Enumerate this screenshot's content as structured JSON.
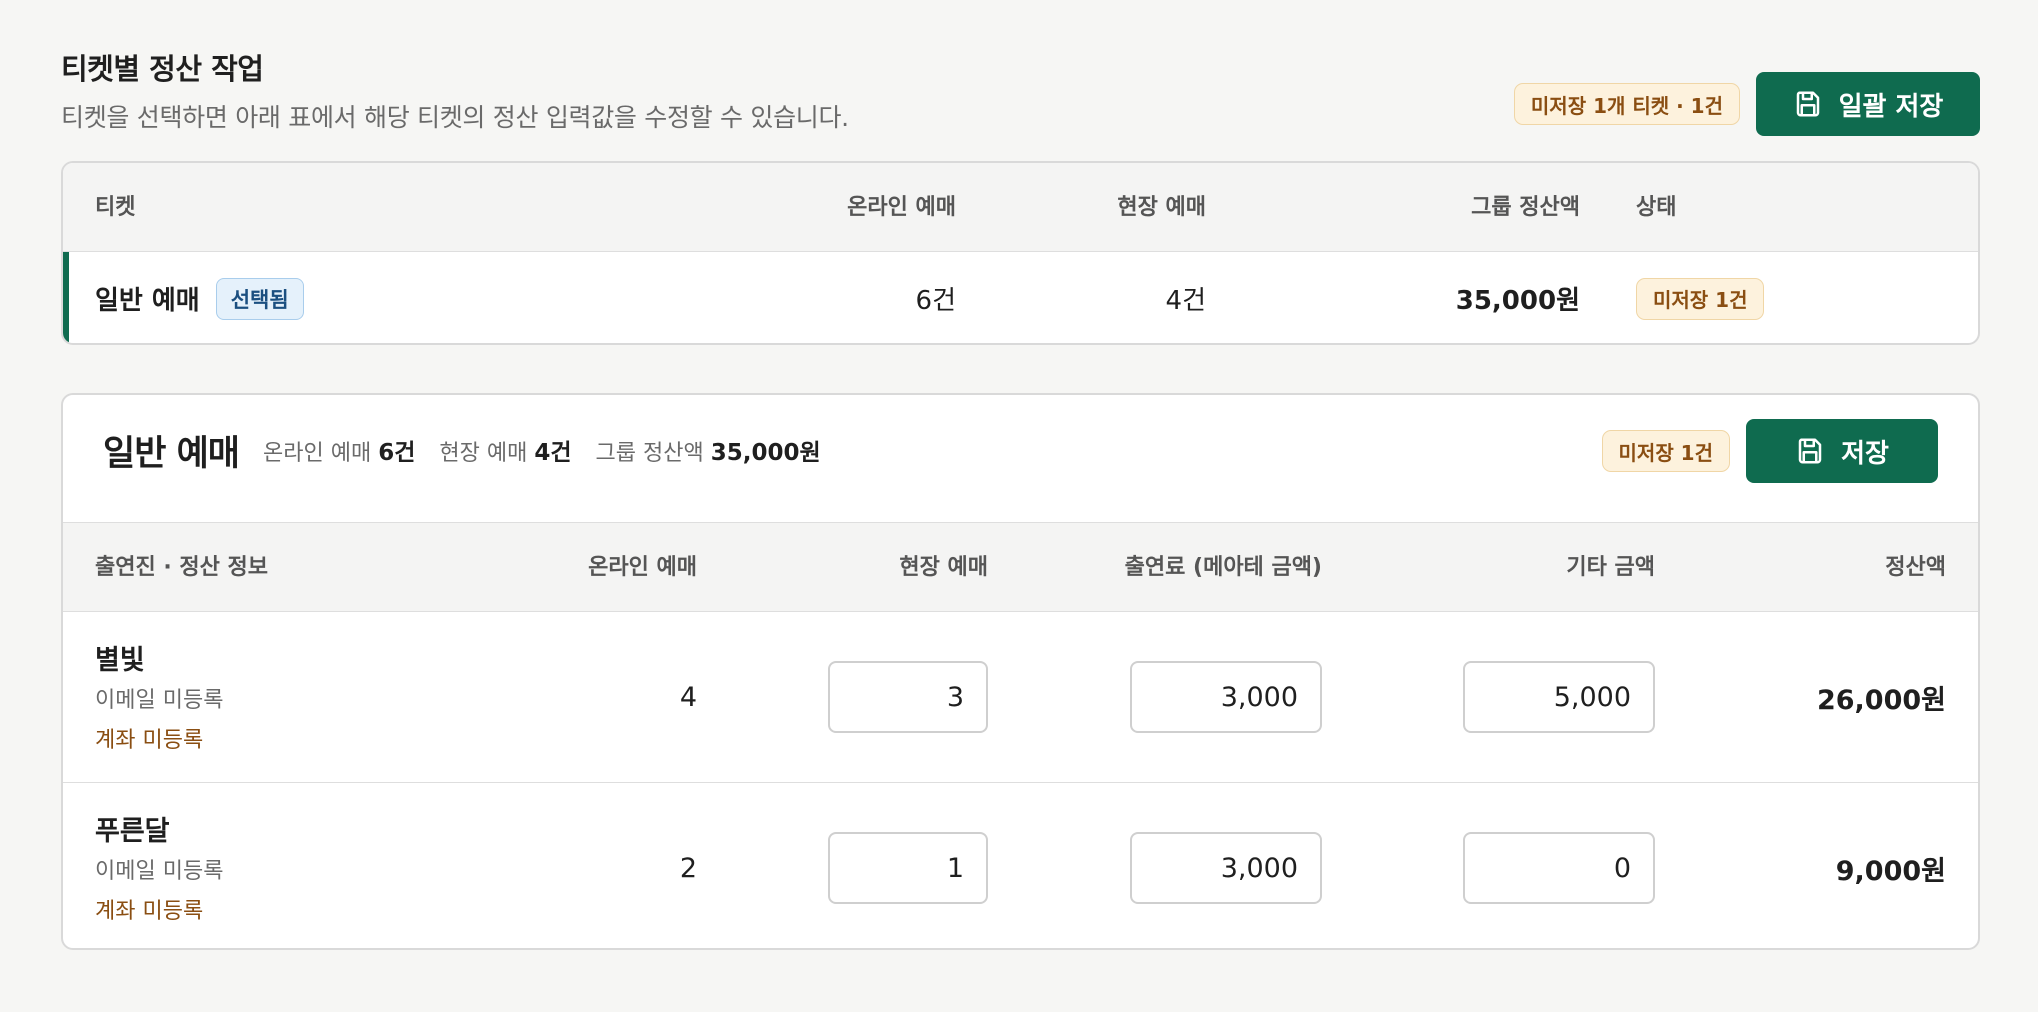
{
  "header": {
    "title": "티켓별 정산 작업",
    "subtitle": "티켓을 선택하면 아래 표에서 해당 티켓의 정산 입력값을 수정할 수 있습니다.",
    "unsaved_badge": "미저장 1개 티켓 · 1건",
    "bulk_save_label": "일괄 저장"
  },
  "ticket_table": {
    "columns": [
      "티켓",
      "온라인 예매",
      "현장 예매",
      "그룹 정산액",
      "상태"
    ],
    "rows": [
      {
        "name": "일반 예매",
        "selected_badge": "선택됨",
        "online": "6건",
        "onsite": "4건",
        "group_total": "35,000원",
        "status": "미저장 1건"
      }
    ]
  },
  "detail": {
    "title": "일반 예매",
    "meta": {
      "online_label": "온라인 예매",
      "online_value": "6건",
      "onsite_label": "현장 예매",
      "onsite_value": "4건",
      "total_label": "그룹 정산액",
      "total_value": "35,000원"
    },
    "unsaved_badge": "미저장 1건",
    "save_label": "저장",
    "columns": [
      "출연진 · 정산 정보",
      "온라인 예매",
      "현장 예매",
      "출연료 (메아테 금액)",
      "기타 금액",
      "정산액"
    ],
    "performers": [
      {
        "name": "별빛",
        "email": "이메일 미등록",
        "account": "계좌 미등록",
        "online": "4",
        "onsite": "3",
        "fee": "3,000",
        "other": "5,000",
        "settlement": "26,000원"
      },
      {
        "name": "푸른달",
        "email": "이메일 미등록",
        "account": "계좌 미등록",
        "online": "2",
        "onsite": "1",
        "fee": "3,000",
        "other": "0",
        "settlement": "9,000원"
      }
    ]
  },
  "colors": {
    "primary": "#0f6b4f",
    "warn_bg": "#fdf2dd",
    "warn_text": "#8a4e12",
    "info_bg": "#e5f1fb"
  },
  "icons": {
    "save": "floppy-disk-icon"
  }
}
